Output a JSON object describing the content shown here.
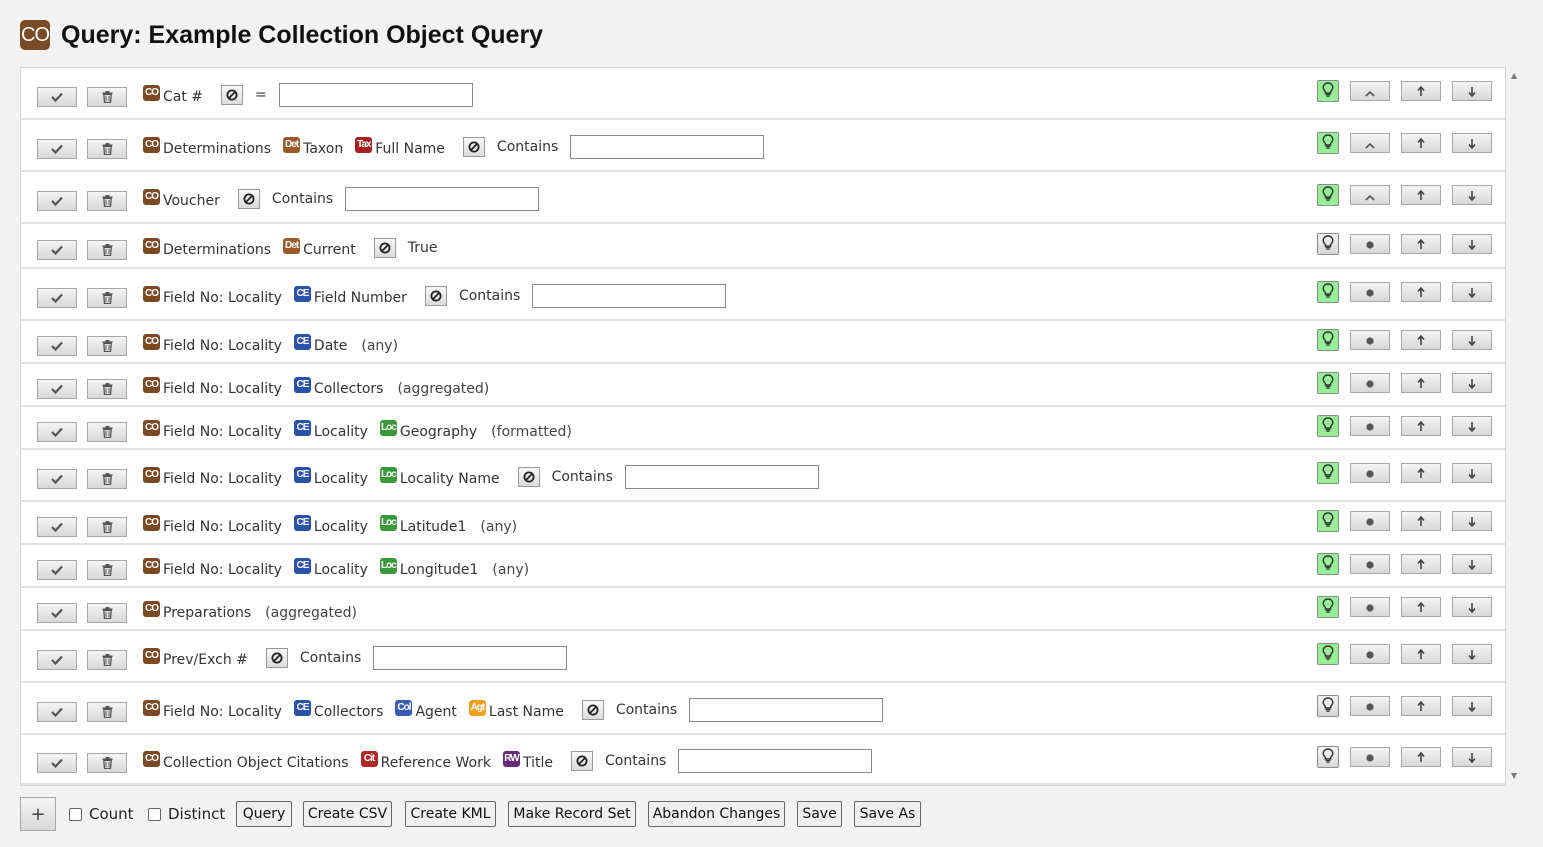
{
  "app": {
    "title": "Query: Example Collection Object Query",
    "logo_text": "CO"
  },
  "icons": {
    "apply": "checkmark-icon",
    "delete": "trash-icon",
    "negate": "not-equal-icon",
    "display": "lightbulb-icon",
    "sort": "sort-icon",
    "up": "arrow-up-icon",
    "down": "arrow-down-icon",
    "add": "plus-icon"
  },
  "colors": {
    "display_on": "#96ee96",
    "collection_object": "#7c4a22",
    "collecting_event": "#2a52a8",
    "locality": "#3a9a3a"
  },
  "rows": [
    {
      "path": [
        {
          "badge": "CO",
          "label": "Cat #"
        }
      ],
      "negate": true,
      "operator": "=",
      "value": "",
      "display": true,
      "sort": "ascending"
    },
    {
      "path": [
        {
          "badge": "CO",
          "label": "Determinations"
        },
        {
          "badge": "Det",
          "label": "Taxon"
        },
        {
          "badge": "Tax",
          "label": "Full Name"
        }
      ],
      "negate": true,
      "operator": "Contains",
      "value": "",
      "display": true,
      "sort": "ascending"
    },
    {
      "path": [
        {
          "badge": "CO",
          "label": "Voucher"
        }
      ],
      "negate": true,
      "operator": "Contains",
      "value": "",
      "display": true,
      "sort": "ascending"
    },
    {
      "path": [
        {
          "badge": "CO",
          "label": "Determinations"
        },
        {
          "badge": "Det",
          "label": "Current"
        }
      ],
      "negate": true,
      "operator": "True",
      "display": false,
      "sort": "none"
    },
    {
      "path": [
        {
          "badge": "CO",
          "label": "Field No: Locality"
        },
        {
          "badge": "CE",
          "label": "Field Number"
        }
      ],
      "negate": true,
      "operator": "Contains",
      "value": "",
      "display": true,
      "sort": "none"
    },
    {
      "path": [
        {
          "badge": "CO",
          "label": "Field No: Locality"
        },
        {
          "badge": "CE",
          "label": "Date"
        }
      ],
      "suffix": "(any)",
      "display": true,
      "sort": "none"
    },
    {
      "path": [
        {
          "badge": "CO",
          "label": "Field No: Locality"
        },
        {
          "badge": "CE",
          "label": "Collectors"
        }
      ],
      "suffix": "(aggregated)",
      "display": true,
      "sort": "none"
    },
    {
      "path": [
        {
          "badge": "CO",
          "label": "Field No: Locality"
        },
        {
          "badge": "CE",
          "label": "Locality"
        },
        {
          "badge": "Loc",
          "label": "Geography"
        }
      ],
      "suffix": "(formatted)",
      "display": true,
      "sort": "none"
    },
    {
      "path": [
        {
          "badge": "CO",
          "label": "Field No: Locality"
        },
        {
          "badge": "CE",
          "label": "Locality"
        },
        {
          "badge": "Loc",
          "label": "Locality Name"
        }
      ],
      "negate": true,
      "operator": "Contains",
      "value": "",
      "display": true,
      "sort": "none"
    },
    {
      "path": [
        {
          "badge": "CO",
          "label": "Field No: Locality"
        },
        {
          "badge": "CE",
          "label": "Locality"
        },
        {
          "badge": "Loc",
          "label": "Latitude1"
        }
      ],
      "suffix": "(any)",
      "display": true,
      "sort": "none"
    },
    {
      "path": [
        {
          "badge": "CO",
          "label": "Field No: Locality"
        },
        {
          "badge": "CE",
          "label": "Locality"
        },
        {
          "badge": "Loc",
          "label": "Longitude1"
        }
      ],
      "suffix": "(any)",
      "display": true,
      "sort": "none"
    },
    {
      "path": [
        {
          "badge": "CO",
          "label": "Preparations"
        }
      ],
      "suffix": "(aggregated)",
      "display": true,
      "sort": "none"
    },
    {
      "path": [
        {
          "badge": "CO",
          "label": "Prev/Exch #"
        }
      ],
      "negate": true,
      "operator": "Contains",
      "value": "",
      "display": true,
      "sort": "none"
    },
    {
      "path": [
        {
          "badge": "CO",
          "label": "Field No: Locality"
        },
        {
          "badge": "CE",
          "label": "Collectors"
        },
        {
          "badge": "Col",
          "label": "Agent"
        },
        {
          "badge": "Agt",
          "label": "Last Name"
        }
      ],
      "negate": true,
      "operator": "Contains",
      "value": "",
      "display": false,
      "sort": "none"
    },
    {
      "path": [
        {
          "badge": "CO",
          "label": "Collection Object Citations"
        },
        {
          "badge": "Cit",
          "label": "Reference Work"
        },
        {
          "badge": "RW",
          "label": "Title"
        }
      ],
      "negate": true,
      "operator": "Contains",
      "value": "",
      "display": false,
      "sort": "none"
    }
  ],
  "footer": {
    "count_label": "Count",
    "distinct_label": "Distinct",
    "count_checked": false,
    "distinct_checked": false,
    "buttons": [
      "Query",
      "Create CSV",
      "Create KML",
      "Make Record Set",
      "Abandon Changes",
      "Save",
      "Save As"
    ]
  }
}
